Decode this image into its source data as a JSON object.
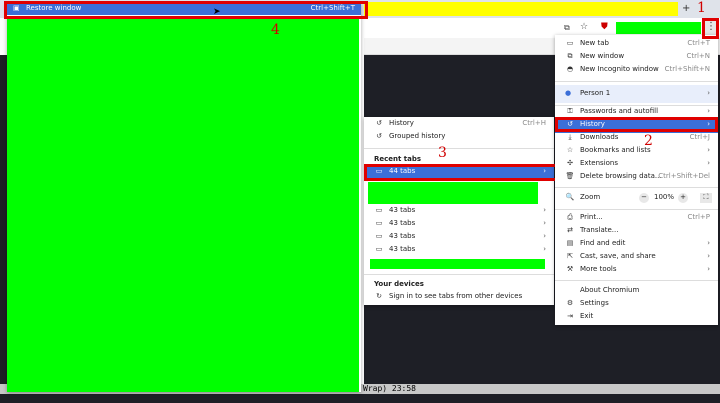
{
  "top_menu": {
    "restore_label": "Restore window",
    "restore_shortcut": "Ctrl+Shift+T",
    "restore_icon": "window-icon"
  },
  "toolbar": {
    "new_tab_symbol": "+",
    "cast_symbol": "⧉",
    "star_symbol": "☆",
    "ext_symbol": "⛊",
    "menu_symbol": "⋮"
  },
  "terminal": {
    "status_text": "Wrap) 23:58"
  },
  "main_menu": {
    "items": [
      {
        "icon": "▭",
        "label": "New tab",
        "shortcut": "Ctrl+T"
      },
      {
        "icon": "⧉",
        "label": "New window",
        "shortcut": "Ctrl+N"
      },
      {
        "icon": "◓",
        "label": "New Incognito window",
        "shortcut": "Ctrl+Shift+N"
      }
    ],
    "person": {
      "icon": "●",
      "label": "Person 1",
      "arrow": "›"
    },
    "group2": [
      {
        "icon": "⚿",
        "label": "Passwords and autofill",
        "shortcut": "",
        "arrow": "›"
      },
      {
        "icon": "↺",
        "label": "History",
        "shortcut": "",
        "arrow": "›"
      },
      {
        "icon": "⤓",
        "label": "Downloads",
        "shortcut": "Ctrl+J",
        "arrow": ""
      },
      {
        "icon": "☆",
        "label": "Bookmarks and lists",
        "shortcut": "",
        "arrow": "›"
      },
      {
        "icon": "✣",
        "label": "Extensions",
        "shortcut": "",
        "arrow": "›"
      },
      {
        "icon": "🗑",
        "label": "Delete browsing data...",
        "shortcut": "Ctrl+Shift+Del",
        "arrow": ""
      }
    ],
    "zoom": {
      "icon": "🔍",
      "label": "Zoom",
      "minus": "−",
      "value": "100%",
      "plus": "+",
      "fullscreen": "⛶"
    },
    "group3": [
      {
        "icon": "⎙",
        "label": "Print...",
        "shortcut": "Ctrl+P",
        "arrow": ""
      },
      {
        "icon": "⇄",
        "label": "Translate...",
        "shortcut": "",
        "arrow": ""
      },
      {
        "icon": "▤",
        "label": "Find and edit",
        "shortcut": "",
        "arrow": "›"
      },
      {
        "icon": "⇱",
        "label": "Cast, save, and share",
        "shortcut": "",
        "arrow": "›"
      },
      {
        "icon": "⚒",
        "label": "More tools",
        "shortcut": "",
        "arrow": "›"
      }
    ],
    "group4": [
      {
        "icon": "",
        "label": "About Chromium",
        "shortcut": "",
        "arrow": ""
      },
      {
        "icon": "⚙",
        "label": "Settings",
        "shortcut": "",
        "arrow": ""
      },
      {
        "icon": "⇥",
        "label": "Exit",
        "shortcut": "",
        "arrow": ""
      }
    ]
  },
  "history_menu": {
    "history": {
      "icon": "↺",
      "label": "History",
      "shortcut": "Ctrl+H"
    },
    "grouped": {
      "icon": "↺",
      "label": "Grouped history"
    },
    "recent_tabs_header": "Recent tabs",
    "selected_tab": {
      "icon": "▭",
      "label": "44 tabs",
      "arrow": "›"
    },
    "tab_groups": [
      {
        "icon": "▭",
        "label": "43 tabs",
        "arrow": "›"
      },
      {
        "icon": "▭",
        "label": "43 tabs",
        "arrow": "›"
      },
      {
        "icon": "▭",
        "label": "43 tabs",
        "arrow": "›"
      },
      {
        "icon": "▭",
        "label": "43 tabs",
        "arrow": "›"
      }
    ],
    "devices_header": "Your devices",
    "sign_in": {
      "icon": "↻",
      "label": "Sign in to see tabs from other devices"
    }
  },
  "annotations": {
    "a1": "1",
    "a2": "2",
    "a3": "3",
    "a4": "4"
  }
}
